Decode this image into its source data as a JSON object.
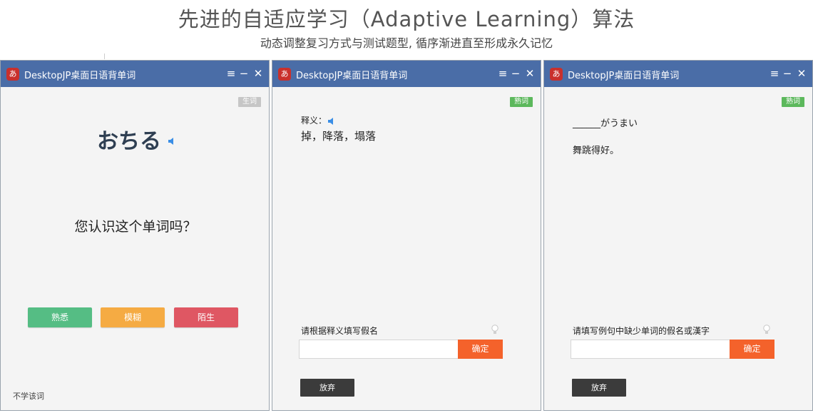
{
  "header": {
    "title": "先进的自适应学习（Adaptive Learning）算法",
    "subtitle": "动态调整复习方式与测试题型, 循序渐进直至形成永久记忆"
  },
  "app": {
    "icon_glyph": "あ",
    "title": "DesktopJP桌面日语背单词"
  },
  "titlebar_icons": {
    "menu": "≡",
    "minimize": "−",
    "close": "✕"
  },
  "window1": {
    "badge": "生词",
    "word": "おちる",
    "question": "您认识这个单词吗？",
    "buttons": {
      "known": "熟悉",
      "fuzzy": "模糊",
      "unknown": "陌生"
    },
    "skip_link": "不学该词"
  },
  "window2": {
    "badge": "熟词",
    "meaning_label": "释义：",
    "meaning": "掉，降落，塌落",
    "instruction": "请根据释义填写假名",
    "input_value": "",
    "confirm": "确定",
    "give_up": "放弃"
  },
  "window3": {
    "badge": "熟词",
    "sentence": "______がうまい",
    "translation": "舞跳得好。",
    "instruction": "请填写例句中缺少单词的假名或漢字",
    "input_value": "",
    "confirm": "确定",
    "give_up": "放弃"
  },
  "colors": {
    "titlebar": "#4a6da7",
    "known": "#55bd84",
    "fuzzy": "#f5ab43",
    "unknown": "#df5763",
    "confirm": "#f4622b",
    "badge_new": "#c6c6c6",
    "badge_familiar": "#5cb85c",
    "speaker": "#3a8ee6"
  },
  "icons": {
    "speaker": "speaker-icon",
    "hint": "lightbulb-icon",
    "app": "app-logo-icon"
  }
}
